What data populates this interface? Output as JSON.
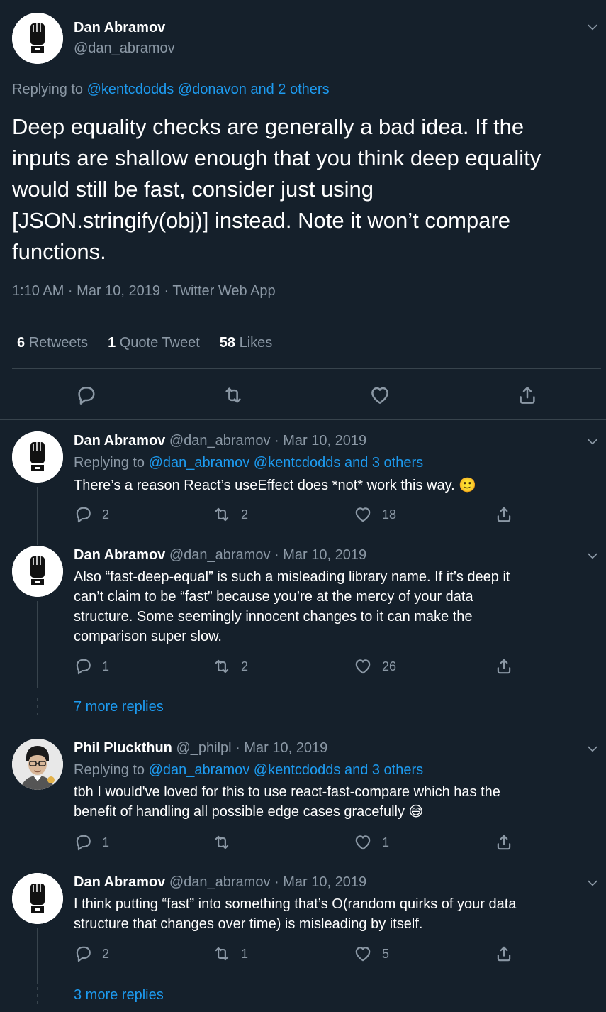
{
  "main_tweet": {
    "author_name": "Dan Abramov",
    "author_handle": "@dan_abramov",
    "replying_prefix": "Replying to",
    "replying_mentions": "@kentcdodds @donavon and 2 others",
    "text_lines": [
      "Deep equality checks are generally a bad idea. If the",
      "inputs are shallow enough that you think deep equality",
      "would still be fast, consider just using",
      "[JSON.stringify(obj)] instead. Note it won’t compare",
      "functions."
    ],
    "meta": "1:10 AM · Mar 10, 2019 · Twitter Web App",
    "stats": {
      "retweets_count": "6",
      "retweets_label": "Retweets",
      "quotes_count": "1",
      "quotes_label": "Quote Tweet",
      "likes_count": "58",
      "likes_label": "Likes"
    }
  },
  "replies": [
    {
      "name": "Dan Abramov",
      "handle": "@dan_abramov",
      "date": "· Mar 10, 2019",
      "replying_prefix": "Replying to",
      "replying_mentions": "@dan_abramov @kentcdodds and 3 others",
      "text_lines": [
        "There’s a reason React’s useEffect does *not* work this way."
      ],
      "emoji": "🙂",
      "reply_count": "2",
      "retweet_count": "2",
      "like_count": "18"
    },
    {
      "name": "Dan Abramov",
      "handle": "@dan_abramov",
      "date": "· Mar 10, 2019",
      "text_lines": [
        "Also “fast-deep-equal” is such a misleading library name. If it’s deep it",
        "can’t claim to be “fast” because you’re at the mercy of your data",
        "structure. Some seemingly innocent changes to it can make the",
        "comparison super slow."
      ],
      "reply_count": "1",
      "retweet_count": "2",
      "like_count": "26"
    },
    {
      "name": "Phil Pluckthun",
      "handle": "@_philpl",
      "date": "· Mar 10, 2019",
      "replying_prefix": "Replying to",
      "replying_mentions": "@dan_abramov @kentcdodds and 3 others",
      "text_lines": [
        "tbh I would've loved for this to use react-fast-compare which has the",
        "benefit of handling all possible edge cases gracefully"
      ],
      "emoji": "😅",
      "reply_count": "1",
      "retweet_count": "",
      "like_count": "1"
    },
    {
      "name": "Dan Abramov",
      "handle": "@dan_abramov",
      "date": "· Mar 10, 2019",
      "text_lines": [
        "I think putting “fast” into something that’s O(random quirks of your data",
        "structure that changes over time) is misleading by itself."
      ],
      "reply_count": "2",
      "retweet_count": "1",
      "like_count": "5"
    }
  ],
  "more_replies_1": "7 more replies",
  "more_replies_2": "3 more replies",
  "colors": {
    "background": "#15202b",
    "link": "#1d9bf0",
    "muted": "#8b98a5",
    "divider": "#38444d"
  },
  "icons": [
    "reply-icon",
    "retweet-icon",
    "like-icon",
    "share-icon",
    "chevron-down-icon"
  ]
}
